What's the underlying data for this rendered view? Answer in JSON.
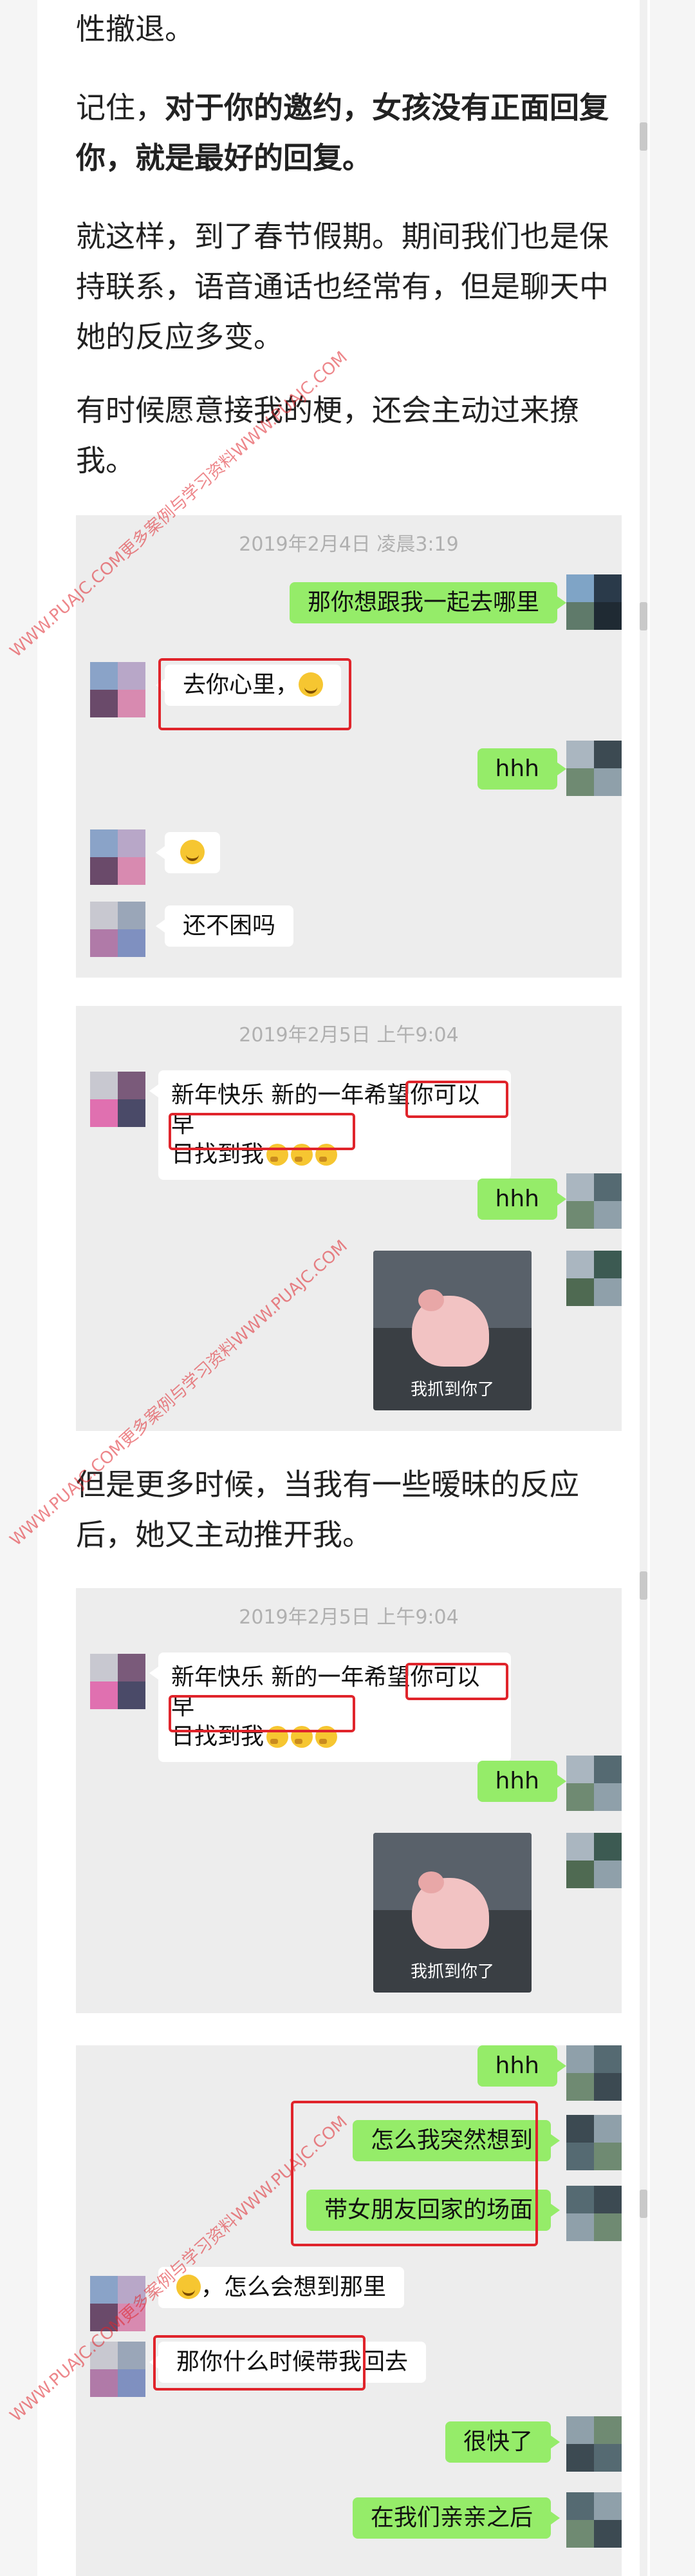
{
  "paragraphs": {
    "p0": "性撤退。",
    "p1_lead": "记住，",
    "p1_bold": "对于你的邀约，女孩没有正面回复你，就是最好的回复。",
    "p2": "就这样，到了春节假期。期间我们也是保持联系，语音通话也经常有，但是聊天中她的反应多变。",
    "p3": "有时候愿意接我的梗，还会主动过来撩我。",
    "p4": "但是更多时候，当我有一些暧昧的反应后，她又主动推开我。"
  },
  "shot1": {
    "timestamp": "2019年2月4日 凌晨3:19",
    "m1": "那你想跟我一起去哪里",
    "m2": "去你心里，",
    "m3": "hhh",
    "m5": "还不困吗"
  },
  "shot2": {
    "timestamp": "2019年2月5日 上午9:04",
    "m1_line1": "新年快乐 新的一年希望你可以早",
    "m1_line2": "日找到我",
    "m2": "hhh",
    "caption": "我抓到你了"
  },
  "shot3": {
    "timestamp": "2019年2月5日 上午9:04",
    "m1_line1": "新年快乐 新的一年希望你可以早",
    "m1_line2": "日找到我",
    "m2": "hhh",
    "caption": "我抓到你了"
  },
  "shot4": {
    "m1": "hhh",
    "m2": "怎么我突然想到",
    "m3": "带女朋友回家的场面",
    "m4": "，怎么会想到那里",
    "m5": "那你什么时候带我回去",
    "m6": "很快了",
    "m7": "在我们亲亲之后"
  },
  "watermark": "WWW.PUAJC.COM更多案例与学习资料WWW.PUAJC.COM",
  "colors": {
    "green_bubble": "#95ec69",
    "red_box": "#e0242b",
    "chat_bg": "#ededed"
  }
}
